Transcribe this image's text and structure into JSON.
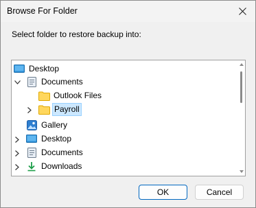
{
  "window": {
    "title": "Browse For Folder"
  },
  "prompt": "Select folder to restore backup into:",
  "tree": {
    "items": [
      {
        "label": "Desktop",
        "icon": "desktop-icon"
      },
      {
        "label": "Documents",
        "icon": "documents-icon",
        "expanded": true
      },
      {
        "label": "Outlook Files",
        "icon": "folder-icon"
      },
      {
        "label": "Payroll",
        "icon": "folder-icon",
        "selected": true
      },
      {
        "label": "Gallery",
        "icon": "gallery-icon"
      },
      {
        "label": "Desktop",
        "icon": "desktop-icon"
      },
      {
        "label": "Documents",
        "icon": "documents-icon"
      },
      {
        "label": "Downloads",
        "icon": "downloads-icon"
      }
    ]
  },
  "buttons": {
    "ok": "OK",
    "cancel": "Cancel"
  },
  "colors": {
    "accent": "#0067c0",
    "selection": "#cce8ff",
    "folder": "#ffd75e"
  }
}
